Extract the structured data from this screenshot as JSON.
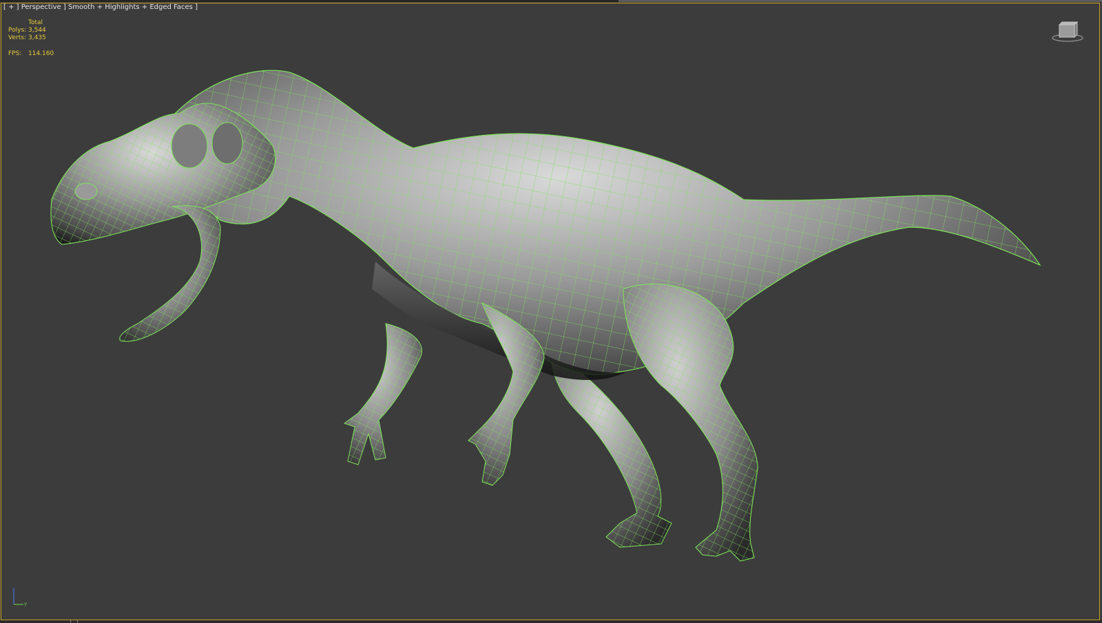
{
  "viewport": {
    "label_open": "[ + ]",
    "label_view": "Perspective",
    "label_sep": "]",
    "label_shading": "Smooth + Highlights + Edged Faces",
    "label_close": "]",
    "background": "#3c3c3c",
    "frame_color": "#c8a224"
  },
  "stats": {
    "header": "Total",
    "polys_label": "Polys:",
    "polys_value": "3,544",
    "verts_label": "Verts:",
    "verts_value": "3,435",
    "fps_label": "FPS:",
    "fps_value": "114.160",
    "color": "#e7cb3c"
  },
  "viewcube": {
    "icon": "viewcube-icon"
  },
  "axis_tripod": {
    "icon": "axis-tripod-icon",
    "z_label": "z",
    "y_label": "y"
  },
  "model": {
    "wire_color": "#7ee35a",
    "shade_light": "#cfcfcf",
    "shade_mid": "#8a8a8a",
    "shade_dark": "#1e1e1e"
  }
}
